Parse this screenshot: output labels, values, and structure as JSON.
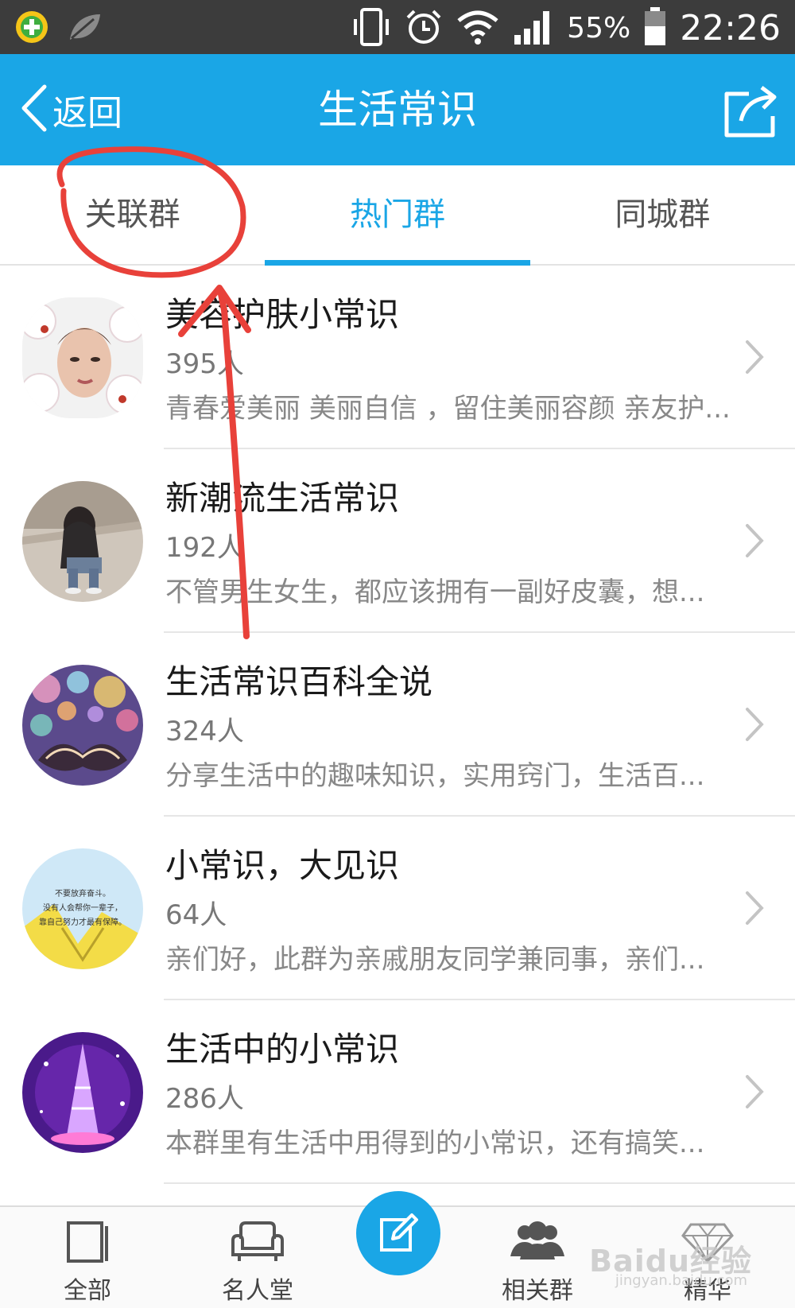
{
  "status_bar": {
    "battery_percent": "55%",
    "time": "22:26"
  },
  "header": {
    "back_label": "返回",
    "title": "生活常识"
  },
  "tabs": [
    {
      "label": "关联群",
      "active": false
    },
    {
      "label": "热门群",
      "active": true
    },
    {
      "label": "同城群",
      "active": false
    }
  ],
  "groups": [
    {
      "name": "美容护肤小常识",
      "count": "395人",
      "desc": "青春爱美丽 美丽自信 ，留住美丽容颜 亲友护...",
      "avatar": "flower-portrait"
    },
    {
      "name": "新潮流生活常识",
      "count": "192人",
      "desc": "不管男生女生，都应该拥有一副好皮囊，想...",
      "avatar": "girl-photo"
    },
    {
      "name": "生活常识百科全说",
      "count": "324人",
      "desc": "分享生活中的趣味知识，实用窍门，生活百...",
      "avatar": "bokeh-heart"
    },
    {
      "name": "小常识，大见识",
      "count": "64人",
      "desc": "亲们好，此群为亲戚朋友同学兼同事，亲们...",
      "avatar": "quote-leaf",
      "avatar_text": [
        "不要放弃奋斗。",
        "没有人会帮你一辈子，",
        "靠自己努力才最有保障。"
      ]
    },
    {
      "name": "生活中的小常识",
      "count": "286人",
      "desc": "本群里有生活中用得到的小常识，还有搞笑...",
      "avatar": "purple-tower"
    }
  ],
  "bottom_bar": {
    "items": [
      {
        "label": "全部",
        "icon": "book-icon"
      },
      {
        "label": "名人堂",
        "icon": "sofa-icon"
      },
      {
        "label": "相关群",
        "icon": "people-icon"
      },
      {
        "label": "精华",
        "icon": "diamond-icon"
      }
    ],
    "compose_icon": "edit-icon"
  },
  "watermark": {
    "brand": "Baidu经验",
    "sub": "jingyan.baidu.com"
  },
  "colors": {
    "accent": "#1aa6e6",
    "annotation": "#e8413a"
  }
}
